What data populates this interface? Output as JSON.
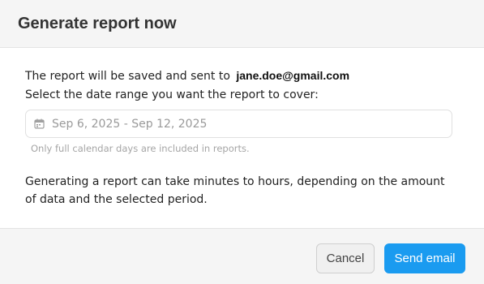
{
  "dialog": {
    "title": "Generate report now"
  },
  "body": {
    "recipient_text": "The report will be saved and sent to",
    "recipient_email": "jane.doe@gmail.com",
    "date_prompt": "Select the date range you want the report to cover:",
    "date_range_value": "Sep 6, 2025 - Sep 12, 2025",
    "date_icon": "calendar-icon",
    "helper_text": "Only full calendar days are included in reports.",
    "note": "Generating a report can take minutes to hours, depending on the amount of data and the selected period."
  },
  "footer": {
    "cancel_label": "Cancel",
    "send_label": "Send email"
  },
  "colors": {
    "primary": "#1a9bf0",
    "header_bg": "#f5f5f5"
  }
}
